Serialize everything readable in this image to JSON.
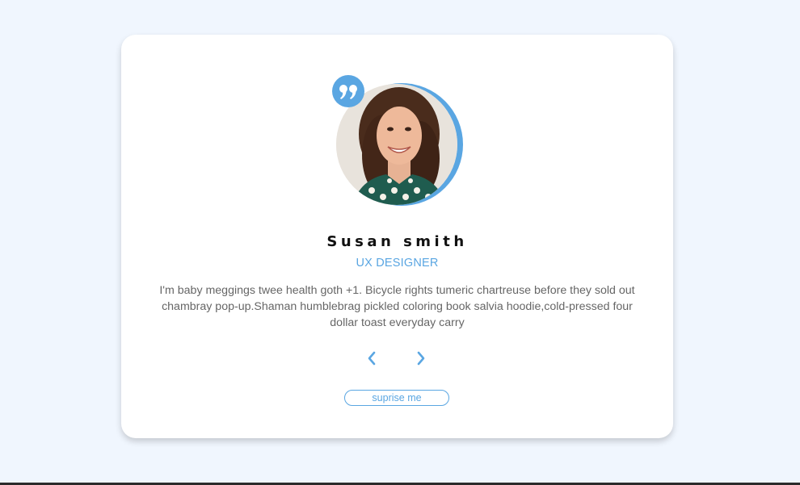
{
  "review": {
    "name": "Susan smith",
    "job": "UX DESIGNER",
    "text": "I'm baby meggings twee health goth +1. Bicycle rights tumeric chartreuse before they sold out chambray pop-up.Shaman humblebrag pickled coloring book salvia hoodie,cold-pressed four dollar toast everyday carry"
  },
  "buttons": {
    "prev_icon": "chevron-left-icon",
    "next_icon": "chevron-right-icon",
    "surprise_label": "suprise me"
  },
  "icons": {
    "quote": "quote-icon"
  },
  "colors": {
    "accent": "#5aa6e2",
    "background": "#f0f6fe",
    "card": "#ffffff",
    "name": "#111111",
    "text": "#666666"
  }
}
